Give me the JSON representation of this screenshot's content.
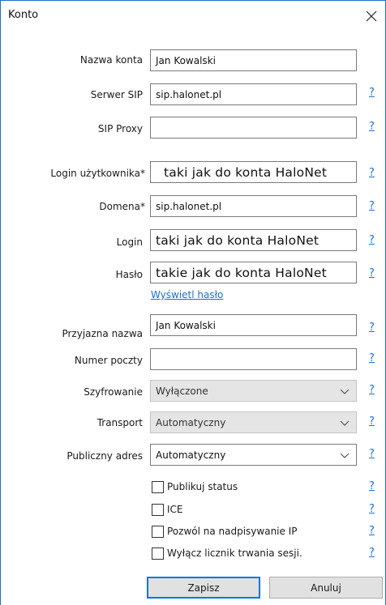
{
  "window": {
    "title": "Konto",
    "close_glyph": "✕"
  },
  "fields": {
    "account_name": {
      "label": "Nazwa konta",
      "value": "Jan Kowalski"
    },
    "sip_server": {
      "label": "Serwer SIP",
      "value": "sip.halonet.pl"
    },
    "sip_proxy": {
      "label": "SIP Proxy",
      "value": ""
    },
    "username": {
      "label": "Login użytkownika",
      "required_mark": "*",
      "value": "taki jak do konta HaloNet"
    },
    "domain": {
      "label": "Domena",
      "required_mark": "*",
      "value": "sip.halonet.pl"
    },
    "login": {
      "label": "Login",
      "value": "taki jak do konta HaloNet"
    },
    "password": {
      "label": "Hasło",
      "value": "takie jak do konta HaloNet"
    },
    "display_name": {
      "label": "Przyjazna nazwa",
      "value": "Jan Kowalski"
    },
    "voicemail": {
      "label": "Numer poczty",
      "value": ""
    }
  },
  "show_password_link": "Wyświetl hasło",
  "selects": {
    "encryption": {
      "label": "Szyfrowanie",
      "value": "Wyłączone"
    },
    "transport": {
      "label": "Transport",
      "value": "Automatyczny"
    },
    "public_address": {
      "label": "Publiczny adres",
      "value": "Automatyczny"
    }
  },
  "checkboxes": {
    "publish_status": "Publikuj status",
    "ice": "ICE",
    "allow_ip_rewrite": "Pozwól na nadpisywanie IP",
    "disable_session_timer": "Wyłącz licznik trwania sesji."
  },
  "help_glyph": "?",
  "buttons": {
    "save": "Zapisz",
    "cancel": "Anuluj"
  },
  "colors": {
    "accent": "#0078d7",
    "link": "#1a6fd6",
    "window_border": "#1e6fc4"
  }
}
